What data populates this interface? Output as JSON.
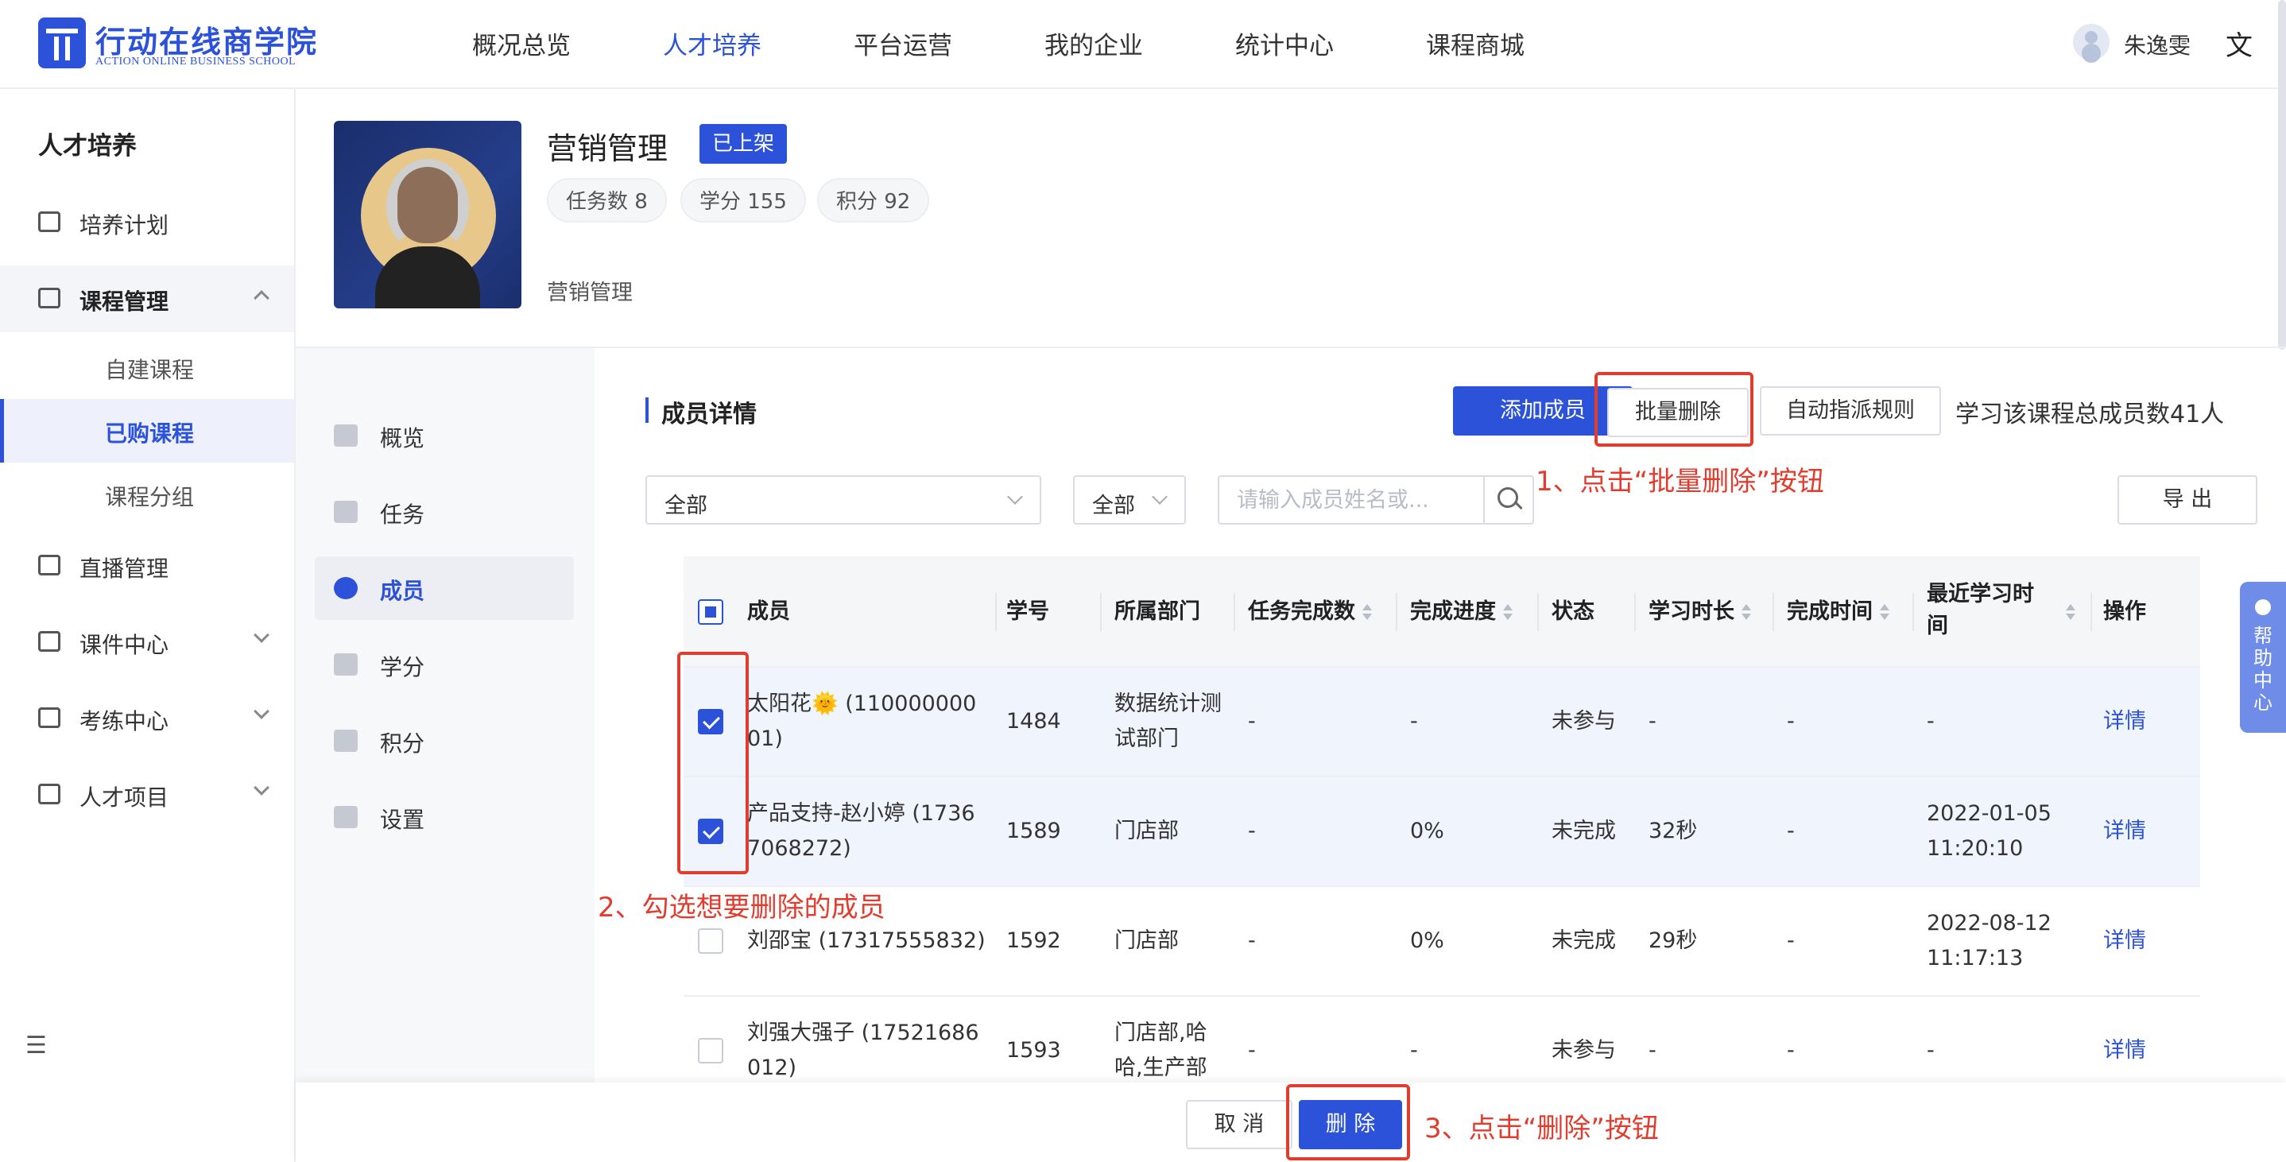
{
  "brand": {
    "name_cn": "行动在线商学院",
    "name_en": "ACTION ONLINE BUSINESS SCHOOL",
    "color": "#2b52d8"
  },
  "topnav": {
    "items": [
      "概况总览",
      "人才培养",
      "平台运营",
      "我的企业",
      "统计中心",
      "课程商城"
    ],
    "active": "人才培养",
    "user_name": "朱逸雯",
    "lang_icon": "translate-icon"
  },
  "sidebar": {
    "title": "人才培养",
    "items": [
      {
        "label": "培养计划",
        "icon": "calendar-icon"
      },
      {
        "label": "课程管理",
        "icon": "book-icon",
        "expanded": true
      },
      {
        "label": "直播管理",
        "icon": "video-icon"
      },
      {
        "label": "课件中心",
        "icon": "inbox-icon"
      },
      {
        "label": "考练中心",
        "icon": "exam-icon"
      },
      {
        "label": "人才项目",
        "icon": "project-icon"
      }
    ],
    "subitems": [
      "自建课程",
      "已购课程",
      "课程分组"
    ],
    "active_subitem": "已购课程"
  },
  "course": {
    "title": "营销管理",
    "status": "已上架",
    "tags": [
      "任务数 8",
      "学分 155",
      "积分 92"
    ],
    "description": "营销管理"
  },
  "subnav": {
    "items": [
      {
        "label": "概览",
        "icon": "chart-icon"
      },
      {
        "label": "任务",
        "icon": "task-icon"
      },
      {
        "label": "成员",
        "icon": "users-icon"
      },
      {
        "label": "学分",
        "icon": "credit-icon"
      },
      {
        "label": "积分",
        "icon": "coins-icon"
      },
      {
        "label": "设置",
        "icon": "settings-icon"
      }
    ],
    "active": "成员"
  },
  "members": {
    "section_title": "成员详情",
    "add_button": "添加成员",
    "batch_delete_button": "批量删除",
    "auto_rule_button": "自动指派规则",
    "total_label": "学习该课程总成员数41人",
    "filter_dept": "全部",
    "filter_status": "全部",
    "search_placeholder": "请输入成员姓名或...",
    "export_button": "导 出"
  },
  "table": {
    "columns": [
      "成员",
      "学号",
      "所属部门",
      "任务完成数",
      "完成进度",
      "状态",
      "学习时长",
      "完成时间",
      "最近学习时间",
      "操作"
    ],
    "rows": [
      {
        "checked": true,
        "member": "太阳花🌞 (11000000001)",
        "id": "1484",
        "dept": "数据统计测试部门",
        "tasks": "-",
        "progress": "-",
        "status": "未参与",
        "duration": "-",
        "done_time": "-",
        "last_time": "-",
        "action": "详情"
      },
      {
        "checked": true,
        "member": "产品支持-赵小婷 (17367068272)",
        "id": "1589",
        "dept": "门店部",
        "tasks": "-",
        "progress": "0%",
        "status": "未完成",
        "duration": "32秒",
        "done_time": "-",
        "last_time": "2022-01-05 11:20:10",
        "action": "详情"
      },
      {
        "checked": false,
        "member": "刘邵宝 (17317555832)",
        "id": "1592",
        "dept": "门店部",
        "tasks": "-",
        "progress": "0%",
        "status": "未完成",
        "duration": "29秒",
        "done_time": "-",
        "last_time": "2022-08-12 11:17:13",
        "action": "详情"
      },
      {
        "checked": false,
        "member": "刘强大强子 (17521686012)",
        "id": "1593",
        "dept": "门店部,哈哈,生产部",
        "tasks": "-",
        "progress": "-",
        "status": "未参与",
        "duration": "-",
        "done_time": "-",
        "last_time": "-",
        "action": "详情"
      }
    ]
  },
  "footer": {
    "cancel_button": "取 消",
    "delete_button": "删 除"
  },
  "annotations": {
    "step1": "1、点击“批量删除”按钮",
    "step2": "2、勾选想要删除的成员",
    "step3": "3、点击“删除”按钮",
    "color": "#e23c2e"
  },
  "help": {
    "label": "帮助中心"
  }
}
